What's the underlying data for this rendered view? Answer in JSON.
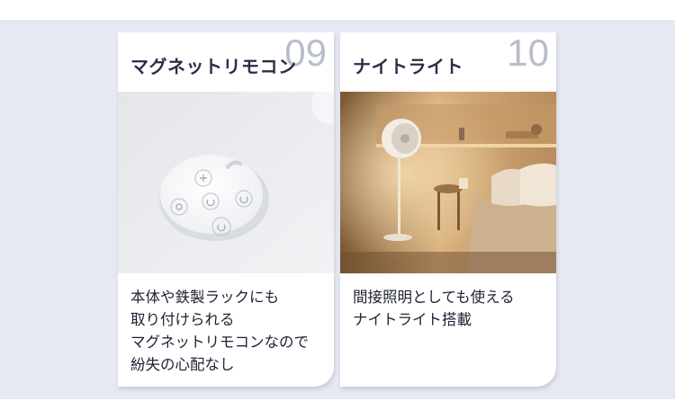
{
  "cards": [
    {
      "number": "09",
      "title": "マグネットリモコン",
      "image": "magnetic-remote-photo",
      "description_lines": [
        "本体や鉄製ラックにも",
        "取り付けられる",
        "マグネットリモコンなので",
        "紛失の心配なし"
      ]
    },
    {
      "number": "10",
      "title": "ナイトライト",
      "image": "night-light-bedroom-photo",
      "description_lines": [
        "間接照明としても使える",
        "ナイトライト搭載"
      ]
    }
  ],
  "colors": {
    "band": "#e6e9f1",
    "title": "#2a2f45",
    "number": "#b7bdcb",
    "text": "#1e2233"
  }
}
